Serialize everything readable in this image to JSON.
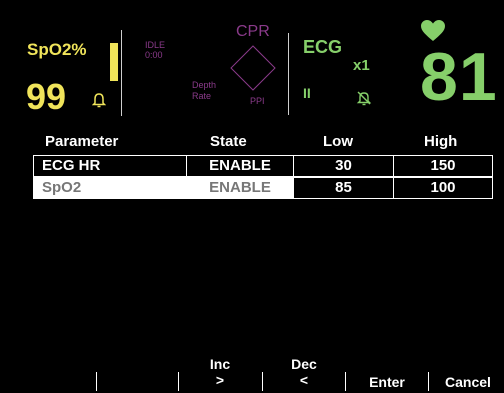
{
  "header": {
    "spo2": {
      "label": "SpO2%",
      "value": "99"
    },
    "idle": {
      "line1": "IDLE",
      "line2": "0:00"
    },
    "cpr": {
      "label": "CPR",
      "depth_label": "Depth",
      "rate_label": "Rate",
      "ppi_label": "PPI"
    },
    "ecg": {
      "label": "ECG",
      "gain": "x1",
      "lead": "II"
    },
    "heart_rate": {
      "value": "81"
    }
  },
  "table": {
    "headers": [
      "Parameter",
      "State",
      "Low",
      "High"
    ],
    "rows": [
      {
        "parameter": "ECG HR",
        "state": "ENABLE",
        "low": "30",
        "high": "150",
        "selected": false
      },
      {
        "parameter": "SpO2",
        "state": "ENABLE",
        "low": "85",
        "high": "100",
        "selected": true
      }
    ]
  },
  "softkeys": [
    {
      "line1": "",
      "line2": ""
    },
    {
      "line1": "",
      "line2": ""
    },
    {
      "line1": "Inc",
      "line2": ">"
    },
    {
      "line1": "Dec",
      "line2": "<"
    },
    {
      "line1": "",
      "line2": "Enter"
    },
    {
      "line1": "",
      "line2": "Cancel"
    }
  ],
  "colors": {
    "spo2": "#f0e45a",
    "ecg": "#86cf6a",
    "cpr": "#8a3a8a",
    "background": "#000000",
    "selected_row": "#ffffff"
  },
  "icons": {
    "spo2_alarm": "bell-icon",
    "ecg_alarm": "alarm-off-icon",
    "heart": "heart-icon",
    "cpr_target": "diamond-icon"
  }
}
